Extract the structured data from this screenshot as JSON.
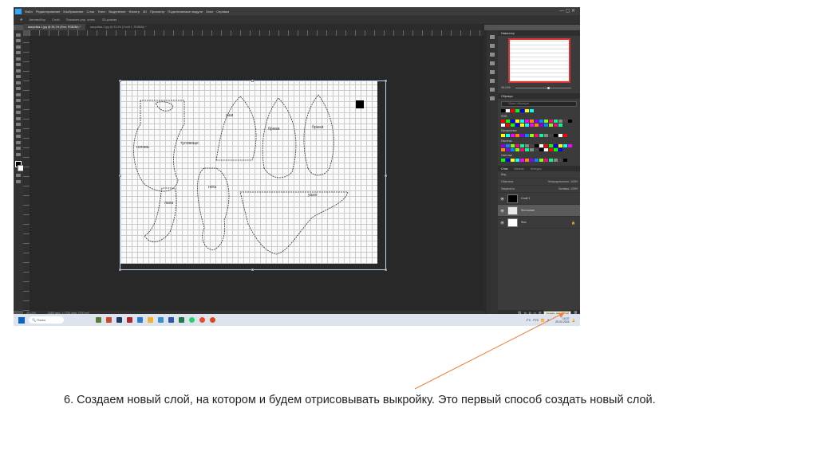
{
  "app": {
    "menu": [
      "Файл",
      "Редактирование",
      "Изображение",
      "Слои",
      "Текст",
      "Выделение",
      "Фильтр",
      "3D",
      "Просмотр",
      "Подключаемые модули",
      "Окно",
      "Справка"
    ],
    "options": [
      "Автовыбор",
      "Слой",
      "Показать упр. элем.",
      "3D-режим"
    ]
  },
  "tabs": [
    {
      "label": "выкройка 1.jpg @ 35,1% (Фон, RGB/8#) *",
      "active": true
    },
    {
      "label": "выкройка 2.jpg @ 33,3% (Слой 1, RGB/8#) *",
      "active": false
    }
  ],
  "status": {
    "zoom": "35,14%",
    "size": "2480 пикс. x 1754 пикс. (300 ppi)"
  },
  "panels": {
    "navigator_title": "Навигатор",
    "zoom_value": "35,14%",
    "swatches_title": "Образцы",
    "swatches_search": "Поиск образцов",
    "folders": [
      "RGB",
      "Прозрачные",
      "Пастель",
      "Светлые"
    ],
    "layers_tabs": [
      "Слои",
      "Каналы",
      "Контуры"
    ],
    "kind_label": "Вид",
    "blend_mode": "Обычные",
    "opacity_label": "Непрозрачность: 100%",
    "lock_label": "Закрепить:",
    "fill_label": "Заливка: 100%",
    "layers": [
      {
        "name": "Слой 1",
        "thumb_color": "#000000",
        "selected": false,
        "lock": ""
      },
      {
        "name": "Фон копия",
        "thumb_color": "#e8e8e8",
        "selected": true,
        "lock": ""
      },
      {
        "name": "Фон",
        "thumb_color": "#ffffff",
        "selected": false,
        "lock": "🔒"
      }
    ],
    "tooltip": "Создать новый слой"
  },
  "taskbar": {
    "search_placeholder": "Поиск",
    "tray_lang": "РУС",
    "time": "16:37",
    "date": "25.03.2024",
    "temp": "2°C"
  },
  "caption": "6. Создаем новый слой, на котором и будем отрисовывать выкройку. Это первый способ создать новый слой.",
  "colors": {
    "arrow": "#f08040",
    "ps_bg": "#535353",
    "accent": "#31a8ff"
  }
}
